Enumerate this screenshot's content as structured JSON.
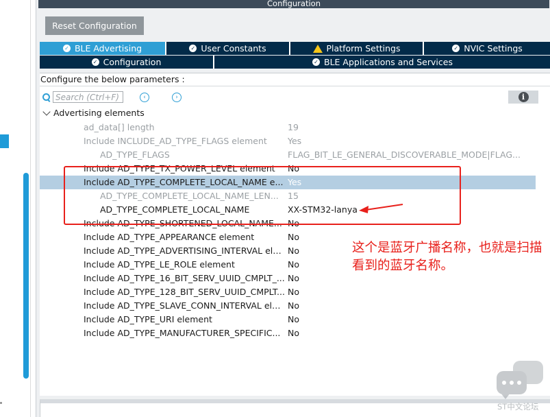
{
  "window": {
    "title": "Configuration"
  },
  "toolbar": {
    "reset_label": "Reset Configuration"
  },
  "tabs_row1": [
    {
      "label": "BLE Advertising",
      "icon": "check-circle-icon",
      "active": true
    },
    {
      "label": "User Constants",
      "icon": "check-circle-icon",
      "active": false
    },
    {
      "label": "Platform Settings",
      "icon": "warning-icon",
      "active": false
    },
    {
      "label": "NVIC Settings",
      "icon": "check-circle-icon",
      "active": false
    }
  ],
  "tabs_row2": [
    {
      "label": "Configuration",
      "icon": "check-circle-icon",
      "active": false
    },
    {
      "label": "BLE Applications and Services",
      "icon": "check-circle-icon",
      "active": false
    }
  ],
  "params": {
    "configure_label": "Configure the below parameters :",
    "search_placeholder": "Search (Ctrl+F)",
    "group_label": "Advertising elements",
    "rows": [
      {
        "name": "ad_data[] length",
        "value": "19"
      },
      {
        "name": "Include INCLUDE_AD_TYPE_FLAGS element",
        "value": "Yes"
      },
      {
        "name": "AD_TYPE_FLAGS",
        "value": "FLAG_BIT_LE_GENERAL_DISCOVERABLE_MODE|FLAG..."
      },
      {
        "name": "Include AD_TYPE_TX_POWER_LEVEL element",
        "value": "No"
      },
      {
        "name": "Include AD_TYPE_COMPLETE_LOCAL_NAME e...",
        "value": "Yes"
      },
      {
        "name": "AD_TYPE_COMPLETE_LOCAL_NAME_LEN...",
        "value": "15"
      },
      {
        "name": "AD_TYPE_COMPLETE_LOCAL_NAME",
        "value": "XX-STM32-lanya"
      },
      {
        "name": "Include AD_TYPE_SHORTENED_LOCAL_NAME...",
        "value": "No"
      },
      {
        "name": "Include AD_TYPE_APPEARANCE element",
        "value": "No"
      },
      {
        "name": "Include AD_TYPE_ADVERTISING_INTERVAL ele...",
        "value": "No"
      },
      {
        "name": "Include AD_TYPE_LE_ROLE element",
        "value": "No"
      },
      {
        "name": "Include AD_TYPE_16_BIT_SERV_UUID_CMPLT_...",
        "value": "No"
      },
      {
        "name": "Include AD_TYPE_128_BIT_SERV_UUID_CMPLT...",
        "value": "No"
      },
      {
        "name": "Include AD_TYPE_SLAVE_CONN_INTERVAL ele...",
        "value": "No"
      },
      {
        "name": "Include AD_TYPE_URI element",
        "value": "No"
      },
      {
        "name": "Include AD_TYPE_MANUFACTURER_SPECIFIC...",
        "value": "No"
      }
    ]
  },
  "annotation": {
    "note": "这个是蓝牙广播名称，也就是扫描看到的蓝牙名称。"
  },
  "watermark": {
    "text": "ST中文论坛"
  },
  "colors": {
    "accent": "#2f9fd5",
    "tab_dark": "#032b49",
    "annotation_red": "#e8201b",
    "selected_row": "#b4cee2"
  }
}
